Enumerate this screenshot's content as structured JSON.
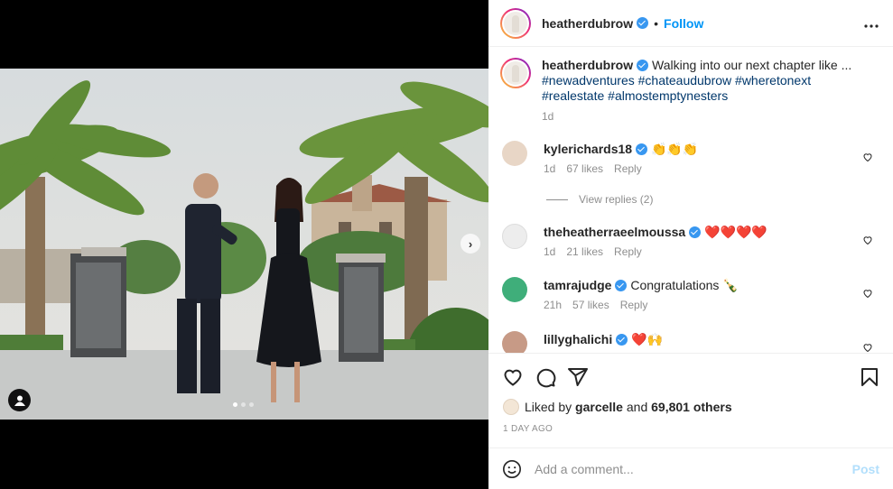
{
  "post": {
    "username": "heatherdubrow",
    "separator": "•",
    "follow_label": "Follow",
    "more_label": "•••",
    "caption_text": "Walking into our next chapter like ...",
    "caption_tags": "#newadventures #chateaudubrow #wheretonext #realestate #almostemptynesters",
    "caption_age": "1d",
    "media_dots": 3,
    "media_active_dot": 1
  },
  "comments": [
    {
      "username": "kylerichards18",
      "text": "👏👏👏",
      "age": "1d",
      "likes": "67 likes",
      "reply": "Reply"
    },
    {
      "username": "theheatherraeelmoussa",
      "text": "❤️❤️❤️❤️",
      "age": "1d",
      "likes": "21 likes",
      "reply": "Reply"
    },
    {
      "username": "tamrajudge",
      "text": "Congratulations 🍾",
      "age": "21h",
      "likes": "57 likes",
      "reply": "Reply"
    },
    {
      "username": "lillyghalichi",
      "text": "❤️🙌"
    }
  ],
  "view_replies": "View replies (2)",
  "likes": {
    "prefix": "Liked by",
    "user": "garcelle",
    "middle": "and",
    "count": "69,801 others"
  },
  "timestamp": "1 DAY AGO",
  "add_comment": {
    "placeholder": "Add a comment...",
    "post_label": "Post"
  },
  "colors": {
    "accent": "#0095f6",
    "verified": "#3897f0",
    "link": "#00376b",
    "muted": "#8e8e8e"
  },
  "icons": [
    "heart-icon",
    "comment-icon",
    "share-icon",
    "save-icon",
    "emoji-icon",
    "user-tag-icon",
    "chevron-right-icon",
    "more-icon",
    "verified-icon"
  ]
}
